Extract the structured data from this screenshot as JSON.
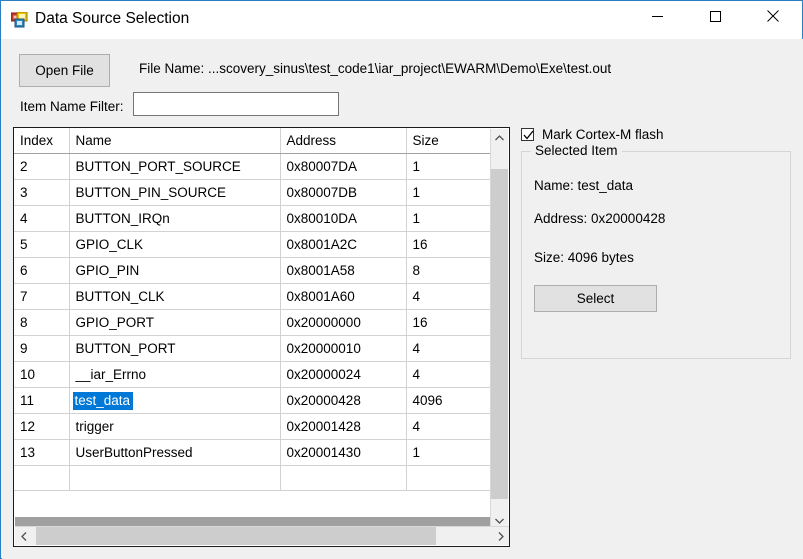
{
  "window": {
    "title": "Data Source Selection",
    "icon": "winforms-app-icon",
    "border_color": "#2a7fc0",
    "controls": {
      "minimize": "minimize-icon",
      "maximize": "maximize-icon",
      "close": "close-icon"
    }
  },
  "toolbar": {
    "open_file_label": "Open File",
    "file_name_text": "File Name: ...scovery_sinus\\test_code1\\iar_project\\EWARM\\Demo\\Exe\\test.out",
    "filter_label": "Item Name Filter:",
    "filter_value": "",
    "filter_placeholder": ""
  },
  "grid": {
    "columns": [
      "Index",
      "Name",
      "Address",
      "Size"
    ],
    "rows": [
      {
        "index": "2",
        "name": "BUTTON_PORT_SOURCE",
        "address": "0x80007DA",
        "size": "1",
        "flash": true,
        "selected": false
      },
      {
        "index": "3",
        "name": "BUTTON_PIN_SOURCE",
        "address": "0x80007DB",
        "size": "1",
        "flash": true,
        "selected": false
      },
      {
        "index": "4",
        "name": "BUTTON_IRQn",
        "address": "0x80010DA",
        "size": "1",
        "flash": true,
        "selected": false
      },
      {
        "index": "5",
        "name": "GPIO_CLK",
        "address": "0x8001A2C",
        "size": "16",
        "flash": true,
        "selected": false
      },
      {
        "index": "6",
        "name": "GPIO_PIN",
        "address": "0x8001A58",
        "size": "8",
        "flash": true,
        "selected": false
      },
      {
        "index": "7",
        "name": "BUTTON_CLK",
        "address": "0x8001A60",
        "size": "4",
        "flash": true,
        "selected": false
      },
      {
        "index": "8",
        "name": "GPIO_PORT",
        "address": "0x20000000",
        "size": "16",
        "flash": false,
        "selected": false
      },
      {
        "index": "9",
        "name": "BUTTON_PORT",
        "address": "0x20000010",
        "size": "4",
        "flash": false,
        "selected": false
      },
      {
        "index": "10",
        "name": "__iar_Errno",
        "address": "0x20000024",
        "size": "4",
        "flash": false,
        "selected": false
      },
      {
        "index": "11",
        "name": "test_data",
        "address": "0x20000428",
        "size": "4096",
        "flash": false,
        "selected": true
      },
      {
        "index": "12",
        "name": "trigger",
        "address": "0x20001428",
        "size": "4",
        "flash": false,
        "selected": false
      },
      {
        "index": "13",
        "name": "UserButtonPressed",
        "address": "0x20001430",
        "size": "1",
        "flash": false,
        "selected": false
      },
      {
        "index": "",
        "name": "",
        "address": "",
        "size": "",
        "flash": false,
        "selected": false
      }
    ],
    "flash_highlight_color": "#ffff00",
    "selection_color": "#0078d7"
  },
  "right_panel": {
    "mark_flash_label": "Mark Cortex-M flash",
    "mark_flash_checked": true,
    "group_title": "Selected Item",
    "name_line": "Name: test_data",
    "address_line": "Address: 0x20000428",
    "size_line": "Size: 4096 bytes",
    "select_button_label": "Select"
  }
}
